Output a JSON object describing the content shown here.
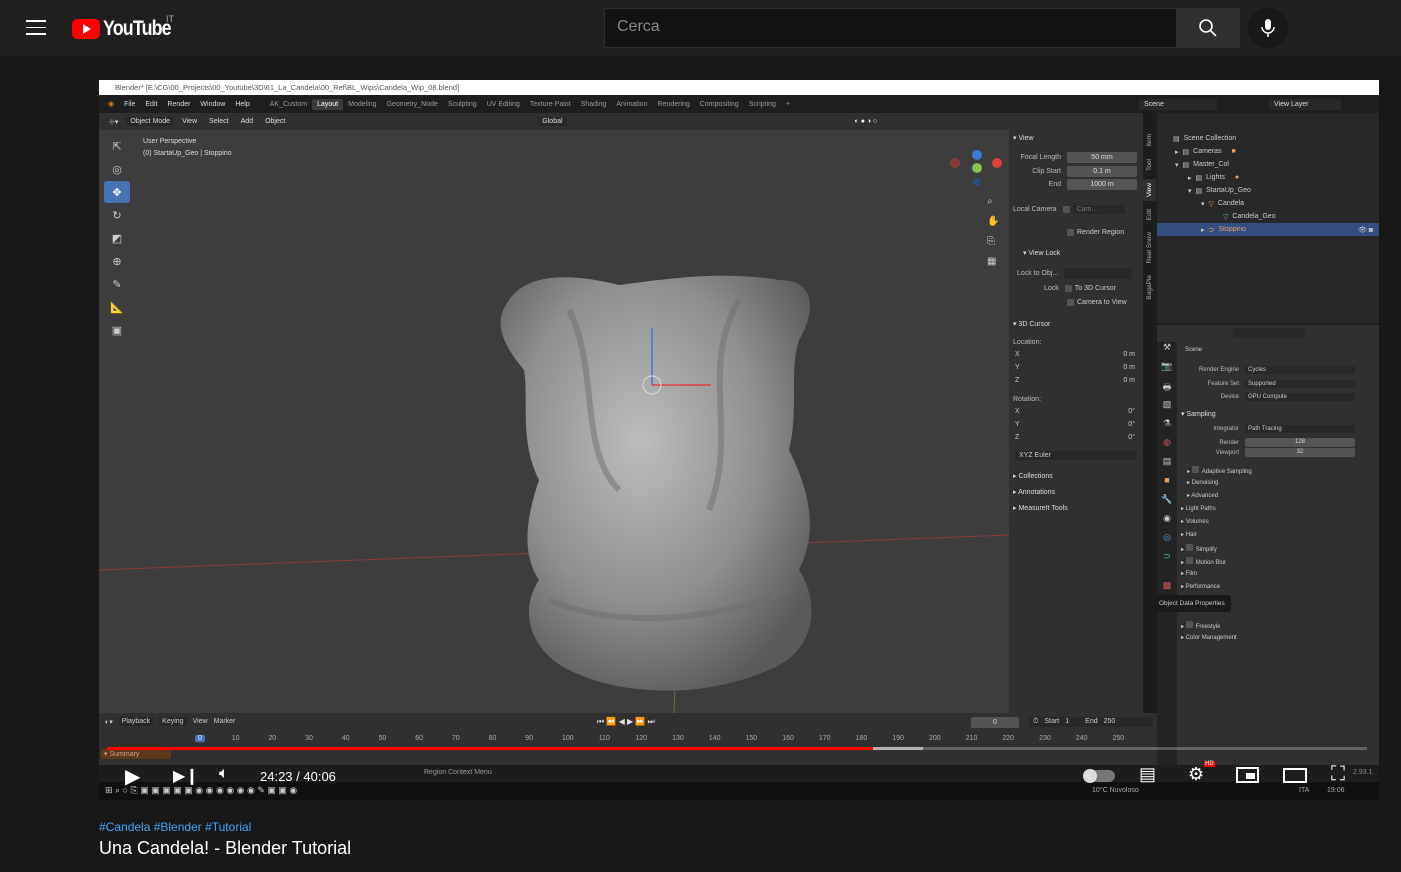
{
  "youtube": {
    "logo": "YouTube",
    "country": "IT",
    "search_placeholder": "Cerca",
    "icons": [
      "menu-icon",
      "search-icon",
      "mic-icon"
    ]
  },
  "blender": {
    "title": "Blender* [E:\\CG\\00_Projects\\00_Youtube\\3D\\61_La_Candela\\00_Ref\\BL_Wips\\Candela_Wip_08.blend]",
    "menu": [
      "File",
      "Edit",
      "Render",
      "Window",
      "Help"
    ],
    "workspaces": [
      "AK_Custom",
      "Layout",
      "Modeling",
      "Geometry_Node",
      "Sculpting",
      "UV Editing",
      "Texture Paint",
      "Shading",
      "Animation",
      "Rendering",
      "Compositing",
      "Scripting"
    ],
    "active_workspace": "Layout",
    "scene": "Scene",
    "view_layer": "View Layer",
    "header": {
      "mode": "Object Mode",
      "items": [
        "View",
        "Select",
        "Add",
        "Object"
      ],
      "orientation": "Global"
    },
    "viewport": {
      "perspective": "User Perspective",
      "object_info": "(0) StartaUp_Geo | Stoppino"
    },
    "npanel": {
      "view_title": "View",
      "focal_length_label": "Focal Length",
      "focal_length": "50 mm",
      "clip_start_label": "Clip Start",
      "clip_start": "0.1 m",
      "end_label": "End",
      "end": "1000 m",
      "local_camera_label": "Local Camera",
      "local_camera": "Cam...",
      "render_region": "Render Region",
      "view_lock_title": "View Lock",
      "lock_to_obj_label": "Lock to Obj...",
      "lock_label": "Lock",
      "to_3d_cursor": "To 3D Cursor",
      "camera_to_view": "Camera to View",
      "cursor_title": "3D Cursor",
      "location_label": "Location:",
      "rotation_label": "Rotation:",
      "location": [
        {
          "axis": "X",
          "value": "0 m"
        },
        {
          "axis": "Y",
          "value": "0 m"
        },
        {
          "axis": "Z",
          "value": "0 m"
        }
      ],
      "rotation": [
        {
          "axis": "X",
          "value": "0°"
        },
        {
          "axis": "Y",
          "value": "0°"
        },
        {
          "axis": "Z",
          "value": "0°"
        }
      ],
      "rotation_mode": "XYZ Euler",
      "collapsed": [
        "Collections",
        "Annotations",
        "MeasureIt Tools"
      ],
      "tabs": [
        "Item",
        "Tool",
        "View",
        "Edit",
        "Real Snow",
        "BagaPie"
      ]
    },
    "outliner": [
      {
        "name": "Scene Collection",
        "indent": 0
      },
      {
        "name": "Cameras",
        "indent": 1
      },
      {
        "name": "Master_Col",
        "indent": 1
      },
      {
        "name": "Lights",
        "indent": 2
      },
      {
        "name": "StartaUp_Geo",
        "indent": 2
      },
      {
        "name": "Candela",
        "indent": 3
      },
      {
        "name": "Candela_Geo",
        "indent": 4
      },
      {
        "name": "Stoppino",
        "indent": 3,
        "selected": true
      }
    ],
    "properties": {
      "context": "Scene",
      "render_engine_label": "Render Engine",
      "render_engine": "Cycles",
      "feature_set_label": "Feature Set",
      "feature_set": "Supported",
      "device_label": "Device",
      "device": "GPU Compute",
      "sampling": "Sampling",
      "integrator_label": "Integrator",
      "integrator": "Path Tracing",
      "render_label": "Render",
      "render_samples": "128",
      "viewport_label": "Viewport",
      "viewport_samples": "32",
      "sub": [
        "Adaptive Sampling",
        "Denoising",
        "Advanced"
      ],
      "panels": [
        "Light Paths",
        "Volumes",
        "Hair",
        "Simplify",
        "Motion Blur",
        "Film",
        "Performance"
      ],
      "panels2": [
        "Freestyle",
        "Color Management"
      ],
      "tooltip": "Object Data Properties"
    },
    "timeline": {
      "menus": [
        "Playback",
        "Keying",
        "View",
        "Marker"
      ],
      "current_frame": "0",
      "start_label": "Start",
      "start": "1",
      "end_label": "End",
      "end": "250",
      "ticks": [
        "0",
        "10",
        "20",
        "30",
        "40",
        "50",
        "60",
        "70",
        "80",
        "90",
        "100",
        "110",
        "120",
        "130",
        "140",
        "150",
        "160",
        "170",
        "180",
        "190",
        "200",
        "210",
        "220",
        "230",
        "240",
        "250"
      ],
      "summary": "Summary"
    },
    "status": {
      "hint": "Region Context Menu",
      "version": "2.93.1"
    },
    "taskbar": {
      "weather": "10°C  Nuvoloso",
      "lang": "ITA",
      "time": "19:06"
    }
  },
  "player": {
    "time": "24:23 / 40:06",
    "progress": 0.608,
    "buffered": 0.648,
    "hd_badge": "HD",
    "accent": "#ff0000"
  },
  "video": {
    "hashtags": "#Candela #Blender #Tutorial",
    "title": "Una Candela! - Blender Tutorial"
  }
}
